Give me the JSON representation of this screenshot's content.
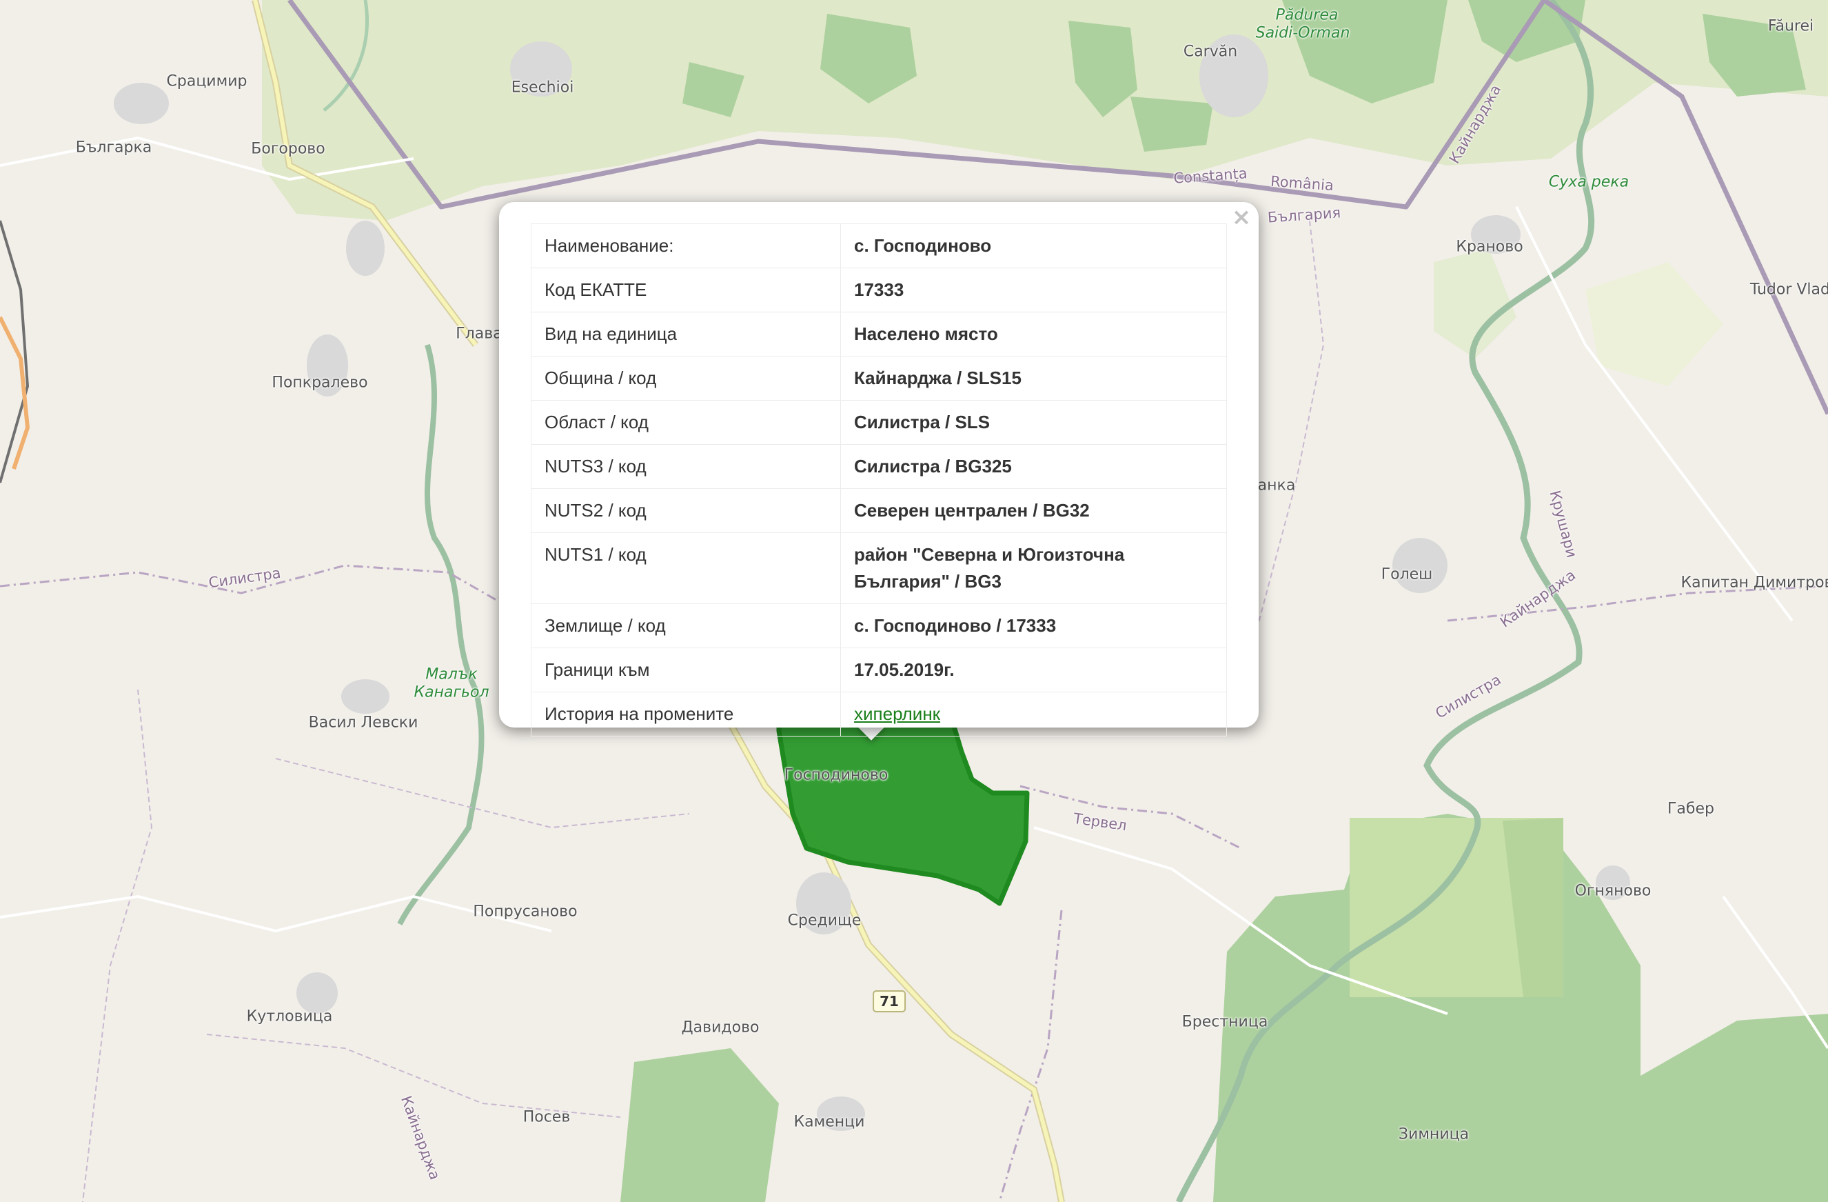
{
  "map": {
    "labels": [
      {
        "text": "Срацимир",
        "type": "place"
      },
      {
        "text": "Българка",
        "type": "place"
      },
      {
        "text": "Богорово",
        "type": "place"
      },
      {
        "text": "Esechioi",
        "type": "place"
      },
      {
        "text": "Carvăn",
        "type": "place"
      },
      {
        "text": "Pădurea",
        "type": "forest"
      },
      {
        "text": "Saidi-Orman",
        "type": "forest"
      },
      {
        "text": "Făurei",
        "type": "place"
      },
      {
        "text": "Constanța",
        "type": "admin"
      },
      {
        "text": "România",
        "type": "admin"
      },
      {
        "text": "България",
        "type": "admin"
      },
      {
        "text": "Кайнарджа",
        "type": "admin"
      },
      {
        "text": "Суха река",
        "type": "water"
      },
      {
        "text": "Кранoво",
        "type": "place"
      },
      {
        "text": "Tudor Vladi",
        "type": "place"
      },
      {
        "text": "Глава",
        "type": "place"
      },
      {
        "text": "Попкралево",
        "type": "place"
      },
      {
        "text": "анка",
        "type": "place"
      },
      {
        "text": "Голеш",
        "type": "place"
      },
      {
        "text": "Капитан Димитров",
        "type": "place"
      },
      {
        "text": "Силистра",
        "type": "admin"
      },
      {
        "text": "Кайнарджа",
        "type": "admin"
      },
      {
        "text": "Силистра",
        "type": "admin"
      },
      {
        "text": "Кpушари",
        "type": "admin"
      },
      {
        "text": "Малък",
        "type": "water"
      },
      {
        "text": "Канагьол",
        "type": "water"
      },
      {
        "text": "Васил Левски",
        "type": "place"
      },
      {
        "text": "Господиново",
        "type": "place"
      },
      {
        "text": "Тервел",
        "type": "admin"
      },
      {
        "text": "Габер",
        "type": "place"
      },
      {
        "text": "Огняново",
        "type": "place"
      },
      {
        "text": "Попрусаново",
        "type": "place"
      },
      {
        "text": "Средище",
        "type": "place"
      },
      {
        "text": "Кутловица",
        "type": "place"
      },
      {
        "text": "Давидово",
        "type": "place"
      },
      {
        "text": "Брестница",
        "type": "place"
      },
      {
        "text": "Посев",
        "type": "place"
      },
      {
        "text": "Каменци",
        "type": "place"
      },
      {
        "text": "Зимница",
        "type": "place"
      },
      {
        "text": "Кайнарджа",
        "type": "admin"
      }
    ],
    "road_shield": "71",
    "colors": {
      "land": "#f2efe9",
      "forest": "#add19e",
      "region_highlight": "#2c9a2c",
      "admin_border": "#ac8fb5",
      "road": "#f7f4b8"
    }
  },
  "popup": {
    "close_label": "×",
    "rows": [
      {
        "key": "Наименование:",
        "value": "с. Господиново"
      },
      {
        "key": "Код ЕКАТТЕ",
        "value": "17333"
      },
      {
        "key": "Вид на единица",
        "value": "Населено място"
      },
      {
        "key": "Община / код",
        "value": "Кайнарджа / SLS15"
      },
      {
        "key": "Област / код",
        "value": "Силистра / SLS"
      },
      {
        "key": "NUTS3 / код",
        "value": "Силистра / BG325"
      },
      {
        "key": "NUTS2 / код",
        "value": "Северен централен / BG32"
      },
      {
        "key": "NUTS1 / код",
        "value": "район \"Северна и Югоизточна България\" / BG3"
      },
      {
        "key": "Землище / код",
        "value": "с. Господиново / 17333"
      },
      {
        "key": "Граници към",
        "value": "17.05.2019г."
      },
      {
        "key": "История на промените",
        "value": "хиперлинк",
        "link": true
      }
    ]
  }
}
